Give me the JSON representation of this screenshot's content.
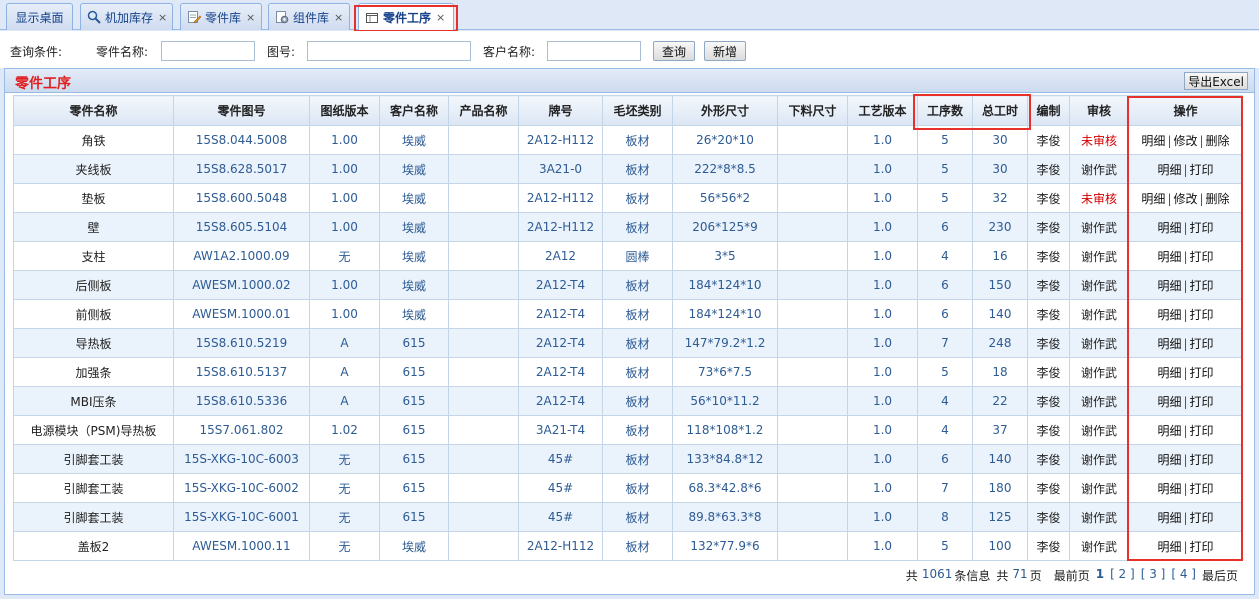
{
  "tabs": [
    {
      "label": "显示桌面",
      "closable": false,
      "icon": "desktop-icon"
    },
    {
      "label": "机加库存",
      "closable": true,
      "icon": "magnifier-icon"
    },
    {
      "label": "零件库",
      "closable": true,
      "icon": "document-edit-icon"
    },
    {
      "label": "组件库",
      "closable": true,
      "icon": "gear-document-icon"
    },
    {
      "label": "零件工序",
      "closable": true,
      "icon": "window-icon",
      "active": true
    }
  ],
  "tab_close_glyph": "×",
  "search": {
    "conditions_label": "查询条件:",
    "part_name_label": "零件名称:",
    "part_name_value": "",
    "drawing_no_label": "图号:",
    "drawing_no_value": "",
    "customer_label": "客户名称:",
    "customer_value": "",
    "query_button": "查询",
    "new_button": "新增"
  },
  "panel": {
    "title": "零件工序",
    "export_button": "导出Excel"
  },
  "table": {
    "columns": [
      "零件名称",
      "零件图号",
      "图纸版本",
      "客户名称",
      "产品名称",
      "牌号",
      "毛坯类别",
      "外形尺寸",
      "下料尺寸",
      "工艺版本",
      "工序数",
      "总工时",
      "编制",
      "审核",
      "操作"
    ],
    "rows": [
      {
        "name": "角铁",
        "drawing": "15S8.044.5008",
        "dver": "1.00",
        "customer": "埃威",
        "product": "",
        "grade": "2A12-H112",
        "blank": "板材",
        "size": "26*20*10",
        "cut": "",
        "pver": "1.0",
        "steps": "5",
        "hours": "30",
        "editor": "李俊",
        "audit": "未审核",
        "pending": true,
        "ops": [
          "明细",
          "修改",
          "删除"
        ]
      },
      {
        "name": "夹线板",
        "drawing": "15S8.628.5017",
        "dver": "1.00",
        "customer": "埃威",
        "product": "",
        "grade": "3A21-0",
        "blank": "板材",
        "size": "222*8*8.5",
        "cut": "",
        "pver": "1.0",
        "steps": "5",
        "hours": "30",
        "editor": "李俊",
        "audit": "谢作武",
        "pending": false,
        "ops": [
          "明细",
          "打印"
        ]
      },
      {
        "name": "垫板",
        "drawing": "15S8.600.5048",
        "dver": "1.00",
        "customer": "埃威",
        "product": "",
        "grade": "2A12-H112",
        "blank": "板材",
        "size": "56*56*2",
        "cut": "",
        "pver": "1.0",
        "steps": "5",
        "hours": "32",
        "editor": "李俊",
        "audit": "未审核",
        "pending": true,
        "ops": [
          "明细",
          "修改",
          "删除"
        ]
      },
      {
        "name": "壁",
        "drawing": "15S8.605.5104",
        "dver": "1.00",
        "customer": "埃威",
        "product": "",
        "grade": "2A12-H112",
        "blank": "板材",
        "size": "206*125*9",
        "cut": "",
        "pver": "1.0",
        "steps": "6",
        "hours": "230",
        "editor": "李俊",
        "audit": "谢作武",
        "pending": false,
        "ops": [
          "明细",
          "打印"
        ]
      },
      {
        "name": "支柱",
        "drawing": "AW1A2.1000.09",
        "dver": "无",
        "customer": "埃威",
        "product": "",
        "grade": "2A12",
        "blank": "圆棒",
        "size": "3*5",
        "cut": "",
        "pver": "1.0",
        "steps": "4",
        "hours": "16",
        "editor": "李俊",
        "audit": "谢作武",
        "pending": false,
        "ops": [
          "明细",
          "打印"
        ]
      },
      {
        "name": "后侧板",
        "drawing": "AWESM.1000.02",
        "dver": "1.00",
        "customer": "埃威",
        "product": "",
        "grade": "2A12-T4",
        "blank": "板材",
        "size": "184*124*10",
        "cut": "",
        "pver": "1.0",
        "steps": "6",
        "hours": "150",
        "editor": "李俊",
        "audit": "谢作武",
        "pending": false,
        "ops": [
          "明细",
          "打印"
        ]
      },
      {
        "name": "前侧板",
        "drawing": "AWESM.1000.01",
        "dver": "1.00",
        "customer": "埃威",
        "product": "",
        "grade": "2A12-T4",
        "blank": "板材",
        "size": "184*124*10",
        "cut": "",
        "pver": "1.0",
        "steps": "6",
        "hours": "140",
        "editor": "李俊",
        "audit": "谢作武",
        "pending": false,
        "ops": [
          "明细",
          "打印"
        ]
      },
      {
        "name": "导热板",
        "drawing": "15S8.610.5219",
        "dver": "A",
        "customer": "615",
        "product": "",
        "grade": "2A12-T4",
        "blank": "板材",
        "size": "147*79.2*1.2",
        "cut": "",
        "pver": "1.0",
        "steps": "7",
        "hours": "248",
        "editor": "李俊",
        "audit": "谢作武",
        "pending": false,
        "ops": [
          "明细",
          "打印"
        ]
      },
      {
        "name": "加强条",
        "drawing": "15S8.610.5137",
        "dver": "A",
        "customer": "615",
        "product": "",
        "grade": "2A12-T4",
        "blank": "板材",
        "size": "73*6*7.5",
        "cut": "",
        "pver": "1.0",
        "steps": "5",
        "hours": "18",
        "editor": "李俊",
        "audit": "谢作武",
        "pending": false,
        "ops": [
          "明细",
          "打印"
        ]
      },
      {
        "name": "MBI压条",
        "drawing": "15S8.610.5336",
        "dver": "A",
        "customer": "615",
        "product": "",
        "grade": "2A12-T4",
        "blank": "板材",
        "size": "56*10*11.2",
        "cut": "",
        "pver": "1.0",
        "steps": "4",
        "hours": "22",
        "editor": "李俊",
        "audit": "谢作武",
        "pending": false,
        "ops": [
          "明细",
          "打印"
        ]
      },
      {
        "name": "电源模块（PSM)导热板",
        "drawing": "15S7.061.802",
        "dver": "1.02",
        "customer": "615",
        "product": "",
        "grade": "3A21-T4",
        "blank": "板材",
        "size": "118*108*1.2",
        "cut": "",
        "pver": "1.0",
        "steps": "4",
        "hours": "37",
        "editor": "李俊",
        "audit": "谢作武",
        "pending": false,
        "ops": [
          "明细",
          "打印"
        ]
      },
      {
        "name": "引脚套工装",
        "drawing": "15S-XKG-10C-6003",
        "dver": "无",
        "customer": "615",
        "product": "",
        "grade": "45#",
        "blank": "板材",
        "size": "133*84.8*12",
        "cut": "",
        "pver": "1.0",
        "steps": "6",
        "hours": "140",
        "editor": "李俊",
        "audit": "谢作武",
        "pending": false,
        "ops": [
          "明细",
          "打印"
        ]
      },
      {
        "name": "引脚套工装",
        "drawing": "15S-XKG-10C-6002",
        "dver": "无",
        "customer": "615",
        "product": "",
        "grade": "45#",
        "blank": "板材",
        "size": "68.3*42.8*6",
        "cut": "",
        "pver": "1.0",
        "steps": "7",
        "hours": "180",
        "editor": "李俊",
        "audit": "谢作武",
        "pending": false,
        "ops": [
          "明细",
          "打印"
        ]
      },
      {
        "name": "引脚套工装",
        "drawing": "15S-XKG-10C-6001",
        "dver": "无",
        "customer": "615",
        "product": "",
        "grade": "45#",
        "blank": "板材",
        "size": "89.8*63.3*8",
        "cut": "",
        "pver": "1.0",
        "steps": "8",
        "hours": "125",
        "editor": "李俊",
        "audit": "谢作武",
        "pending": false,
        "ops": [
          "明细",
          "打印"
        ]
      },
      {
        "name": "盖板2",
        "drawing": "AWESM.1000.11",
        "dver": "无",
        "customer": "埃威",
        "product": "",
        "grade": "2A12-H112",
        "blank": "板材",
        "size": "132*77.9*6",
        "cut": "",
        "pver": "1.0",
        "steps": "5",
        "hours": "100",
        "editor": "李俊",
        "audit": "谢作武",
        "pending": false,
        "ops": [
          "明细",
          "打印"
        ]
      }
    ]
  },
  "pager": {
    "total_prefix": "共",
    "total_count": "1061",
    "total_suffix": "条信息",
    "pages_prefix": "共",
    "pages_count": "71",
    "pages_suffix": "页",
    "first_label": "最前页",
    "current_page": "1",
    "pages": [
      "[ 2 ]",
      "[ 3 ]",
      "[ 4 ]"
    ],
    "last_label": "最后页"
  },
  "colors": {
    "pending_audit": "#d40000",
    "title_red": "#e02020",
    "highlight_box": "#e8302a"
  }
}
